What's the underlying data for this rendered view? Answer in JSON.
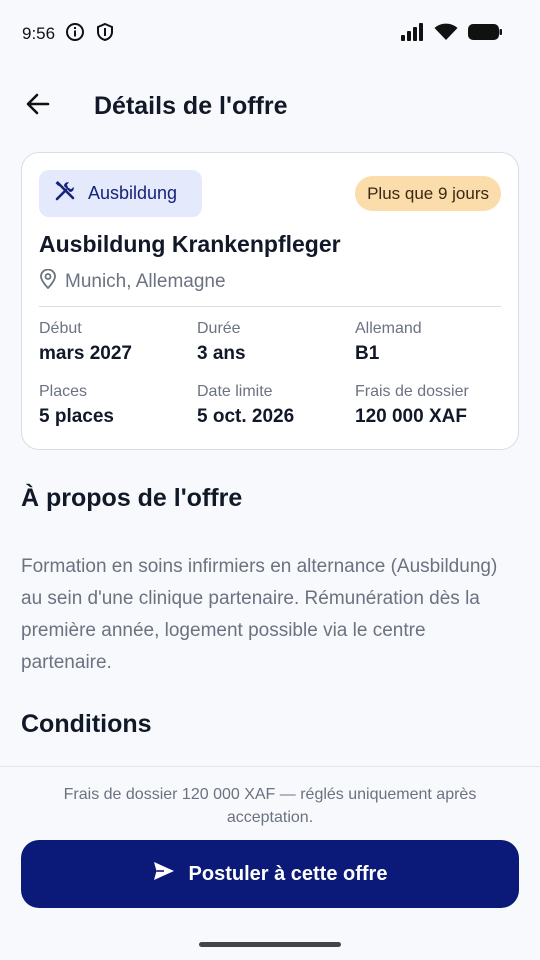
{
  "status_bar": {
    "time": "9:56"
  },
  "header": {
    "title": "Détails de l'offre"
  },
  "offer": {
    "type_label": "Ausbildung",
    "deadline_badge": "Plus que 9 jours",
    "title": "Ausbildung Krankenpfleger",
    "location": "Munich, Allemagne",
    "details": [
      {
        "label": "Début",
        "value": "mars 2027"
      },
      {
        "label": "Durée",
        "value": "3 ans"
      },
      {
        "label": "Allemand",
        "value": "B1"
      },
      {
        "label": "Places",
        "value": "5 places"
      },
      {
        "label": "Date limite",
        "value": "5 oct. 2026"
      },
      {
        "label": "Frais de dossier",
        "value": "120 000 XAF"
      }
    ]
  },
  "about": {
    "title": "À propos de l'offre",
    "text": "Formation en soins infirmiers en alternance (Ausbildung) au sein d'une clinique partenaire. Rémunération dès la première année, logement possible via le centre partenaire."
  },
  "conditions": {
    "title": "Conditions"
  },
  "footer": {
    "fee_note": "Frais de dossier 120 000 XAF — réglés uniquement après acceptation.",
    "apply_label": "Postuler à cette offre"
  },
  "colors": {
    "primary": "#0b1a78",
    "chip_bg": "#e4e9fb",
    "badge_bg": "#fbdcab"
  },
  "icons": [
    "info-icon",
    "shield-icon",
    "signal-icon",
    "wifi-icon",
    "battery-icon",
    "back-arrow-icon",
    "tools-icon",
    "location-pin-icon",
    "send-icon"
  ]
}
